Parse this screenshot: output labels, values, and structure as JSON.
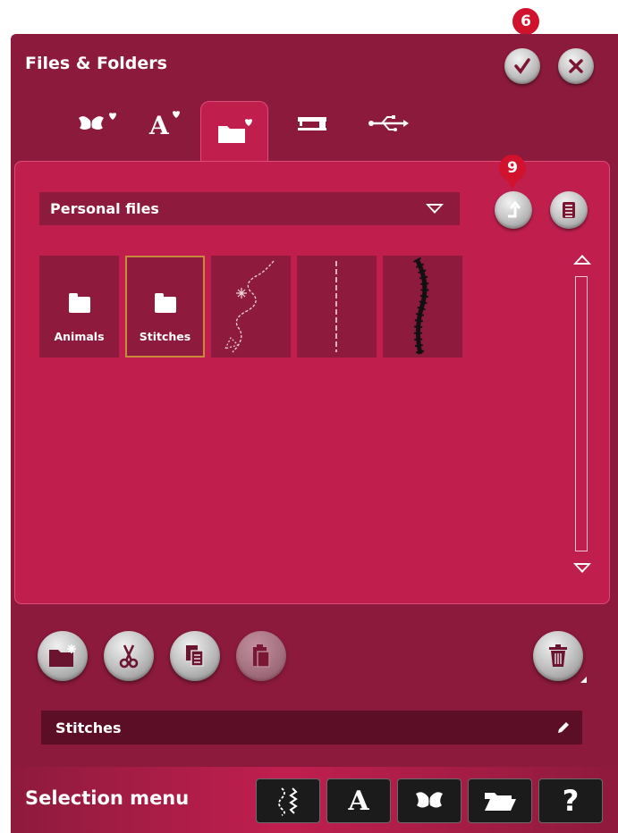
{
  "window": {
    "title": "Files & Folders"
  },
  "header": {
    "confirm_icon": "check-icon",
    "close_icon": "close-icon",
    "confirm_badge": "6"
  },
  "tabs": [
    {
      "name": "embroidery-favorites",
      "icon": "butterfly-heart-icon",
      "active": false
    },
    {
      "name": "font-favorites",
      "icon": "letter-a-heart-icon",
      "active": false
    },
    {
      "name": "personal-files",
      "icon": "folder-heart-icon",
      "active": true
    },
    {
      "name": "machine",
      "icon": "sewing-machine-icon",
      "active": false
    },
    {
      "name": "usb",
      "icon": "usb-icon",
      "active": false
    }
  ],
  "browser": {
    "location": "Personal files",
    "up_badge": "9",
    "files": [
      {
        "type": "folder",
        "label": "Animals",
        "selected": false
      },
      {
        "type": "folder",
        "label": "Stitches",
        "selected": true
      },
      {
        "type": "stitch",
        "label": "",
        "selected": false
      },
      {
        "type": "stitch",
        "label": "",
        "selected": false
      },
      {
        "type": "stitch",
        "label": "",
        "selected": false
      }
    ]
  },
  "toolbar": {
    "buttons": [
      "new-folder",
      "cut",
      "copy",
      "paste",
      "delete"
    ]
  },
  "name_field": {
    "value": "Stitches"
  },
  "selection_menu": {
    "title": "Selection menu",
    "items": [
      "stitch-menu",
      "font-menu",
      "embroidery-menu",
      "file-manager",
      "help"
    ],
    "help_label": "?",
    "font_label": "A"
  },
  "colors": {
    "panel": "#c01f4e",
    "frame": "#8c1a3c",
    "badge": "#d0122d",
    "selection_border": "#c98a3e"
  }
}
